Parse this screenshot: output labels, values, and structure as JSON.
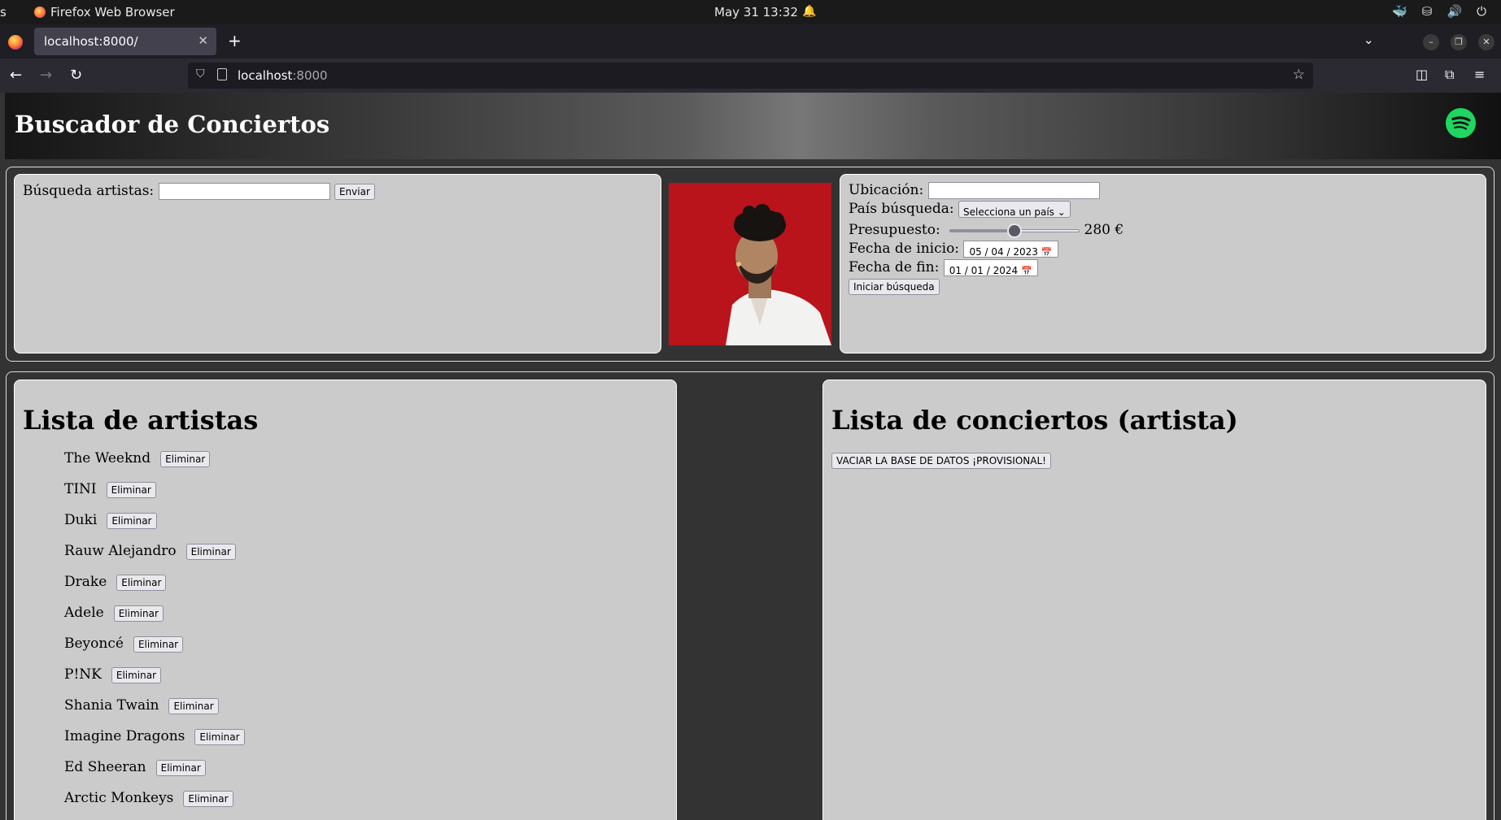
{
  "os": {
    "left_fragment": "s",
    "app_name": "Firefox Web Browser",
    "clock": "May 31  13:32"
  },
  "browser": {
    "tab_title": "localhost:8000/",
    "url_host": "localhost",
    "url_port": ":8000"
  },
  "header": {
    "title": "Buscador de Conciertos"
  },
  "artist_search": {
    "label": "Búsqueda artistas:",
    "value": "",
    "submit_label": "Enviar"
  },
  "filters": {
    "location_label": "Ubicación:",
    "location_value": "",
    "country_label": "País búsqueda:",
    "country_selected": "Selecciona un país",
    "budget_label": "Presupuesto:",
    "budget_value": "280 €",
    "budget_fraction": 0.5,
    "start_label": "Fecha de inicio:",
    "start_date": "05 / 04 / 2023",
    "end_label": "Fecha de fin:",
    "end_date": "01 / 01 / 2024",
    "search_label": "Iniciar búsqueda"
  },
  "artists": {
    "heading": "Lista de artistas",
    "remove_label": "Eliminar",
    "items": [
      "The Weeknd",
      "TINI",
      "Duki",
      "Rauw Alejandro",
      "Drake",
      "Adele",
      "Beyoncé",
      "P!NK",
      "Shania Twain",
      "Imagine Dragons",
      "Ed Sheeran",
      "Arctic Monkeys"
    ]
  },
  "concerts": {
    "heading": "Lista de conciertos (artista)",
    "clear_db_label": "VACIAR LA BASE DE DATOS ¡PROVISIONAL!"
  },
  "colors": {
    "panel_bg": "#cbcbcb",
    "page_bg": "#333333",
    "spotify_green": "#1ed760"
  }
}
